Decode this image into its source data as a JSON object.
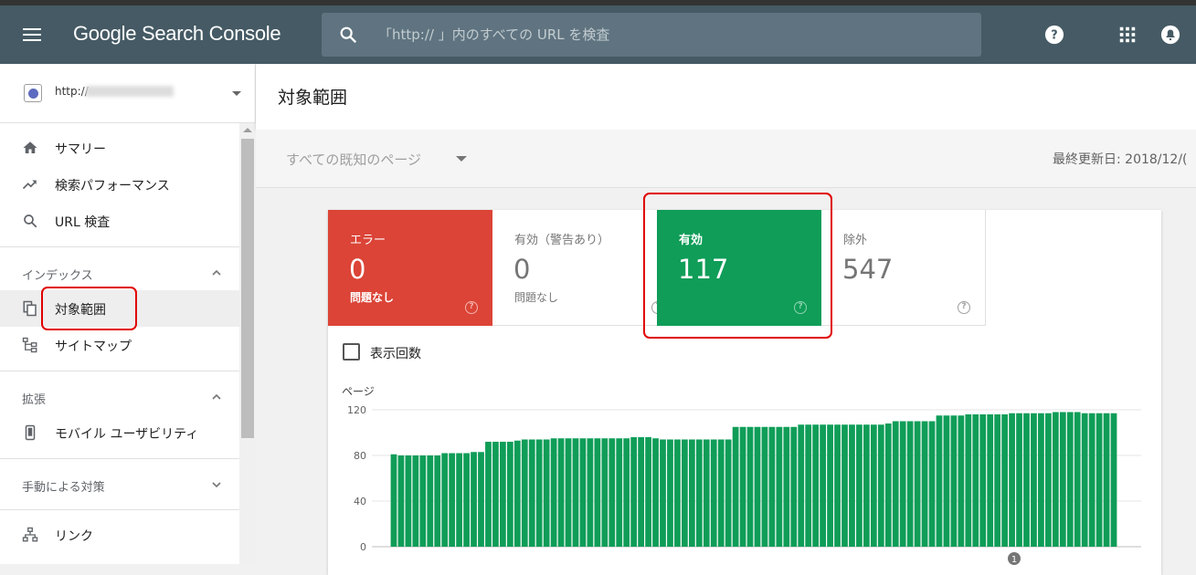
{
  "app": {
    "title": "Google Search Console"
  },
  "search": {
    "placeholder": "「http://           」内のすべての URL を検査"
  },
  "property": {
    "url_prefix": "http://"
  },
  "sidebar": {
    "items": [
      {
        "label": "サマリー",
        "icon": "home-icon"
      },
      {
        "label": "検索パフォーマンス",
        "icon": "trending-up-icon"
      },
      {
        "label": "URL 検査",
        "icon": "search-icon"
      }
    ],
    "index_header": "インデックス",
    "index_items": [
      {
        "label": "対象範囲",
        "icon": "file-copy-icon",
        "active": true
      },
      {
        "label": "サイトマップ",
        "icon": "sitemap-icon"
      }
    ],
    "ext_header": "拡張",
    "ext_items": [
      {
        "label": "モバイル ユーザビリティ",
        "icon": "smartphone-icon"
      }
    ],
    "manual_header": "手動による対策",
    "link_item": {
      "label": "リンク",
      "icon": "links-icon"
    }
  },
  "main": {
    "title": "対象範囲",
    "filter": "すべての既知のページ",
    "updated": "最終更新日: 2018/12/("
  },
  "tiles": [
    {
      "label": "エラー",
      "value": "0",
      "sub": "問題なし",
      "color": "#db4437"
    },
    {
      "label": "有効（警告あり）",
      "value": "0",
      "sub": "問題なし",
      "color": "#ffffff"
    },
    {
      "label": "有効",
      "value": "117",
      "sub": "",
      "color": "#0f9d58"
    },
    {
      "label": "除外",
      "value": "547",
      "sub": "",
      "color": "#ffffff"
    }
  ],
  "impressions_checkbox": {
    "label": "表示回数",
    "checked": false
  },
  "chart_data": {
    "type": "bar",
    "ylabel": "ページ",
    "ylim": [
      0,
      120
    ],
    "yticks": [
      0,
      40,
      80,
      120
    ],
    "color": "#0f9d58",
    "annotation": "1",
    "values": [
      81,
      80,
      80,
      80,
      80,
      80,
      80,
      82,
      82,
      82,
      82,
      83,
      83,
      92,
      92,
      92,
      92,
      93,
      94,
      94,
      94,
      94,
      95,
      95,
      95,
      95,
      95,
      95,
      95,
      95,
      95,
      95,
      95,
      96,
      96,
      96,
      95,
      94,
      94,
      94,
      94,
      94,
      94,
      94,
      94,
      94,
      94,
      105,
      105,
      105,
      105,
      105,
      105,
      105,
      105,
      105,
      107,
      107,
      107,
      107,
      107,
      107,
      107,
      107,
      107,
      107,
      107,
      107,
      108,
      110,
      110,
      110,
      110,
      110,
      110,
      115,
      115,
      115,
      115,
      116,
      116,
      116,
      116,
      116,
      116,
      117,
      117,
      117,
      117,
      117,
      117,
      118,
      118,
      118,
      118,
      117,
      117,
      117,
      117,
      117
    ]
  }
}
